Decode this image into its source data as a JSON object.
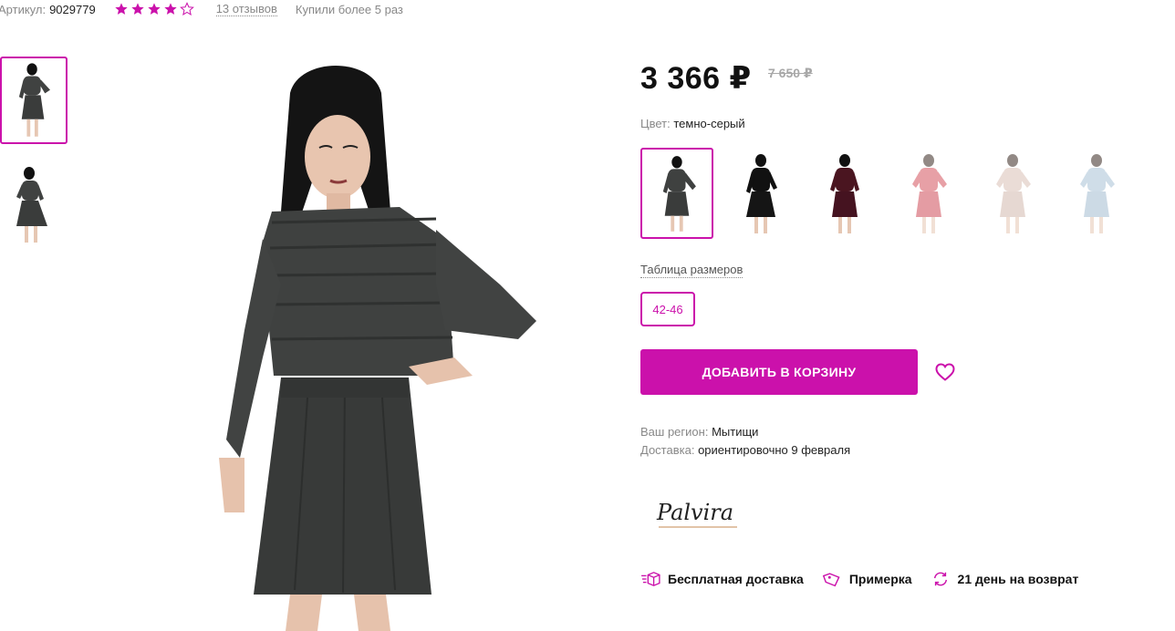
{
  "product": {
    "article_label": "Артикул:",
    "article_value": "9029779",
    "rating_stars": 4,
    "rating_max": 5,
    "reviews": "13 отзывов",
    "bought": "Купили более 5 раз"
  },
  "price": {
    "current": "3 366 ₽",
    "old": "7 650 ₽"
  },
  "color": {
    "label": "Цвет:",
    "value": "темно-серый",
    "swatches": [
      {
        "name": "темно-серый",
        "color": "#3f4140"
      },
      {
        "name": "черный",
        "color": "#111111"
      },
      {
        "name": "бордовый",
        "color": "#4a1520"
      },
      {
        "name": "красный",
        "color": "#d4545e"
      },
      {
        "name": "бежевый",
        "color": "#d9c0b6"
      },
      {
        "name": "голубой",
        "color": "#a9c2d6"
      }
    ]
  },
  "sizes": {
    "table_link": "Таблица размеров",
    "options": [
      "42-46"
    ]
  },
  "actions": {
    "add_to_cart": "ДОБАВИТЬ В КОРЗИНУ"
  },
  "delivery": {
    "region_label": "Ваш регион:",
    "region_value": "Мытищи",
    "delivery_label": "Доставка:",
    "delivery_value": "ориентировочно 9 февраля"
  },
  "brand": {
    "logo_text": "Palvira"
  },
  "features": [
    {
      "icon": "delivery-box-icon",
      "label": "Бесплатная доставка"
    },
    {
      "icon": "tag-icon",
      "label": "Примерка"
    },
    {
      "icon": "refresh-icon",
      "label": "21 день на возврат"
    }
  ],
  "colors": {
    "accent": "#cb11ab",
    "muted_text": "#888888",
    "dress": "#3f4140"
  }
}
